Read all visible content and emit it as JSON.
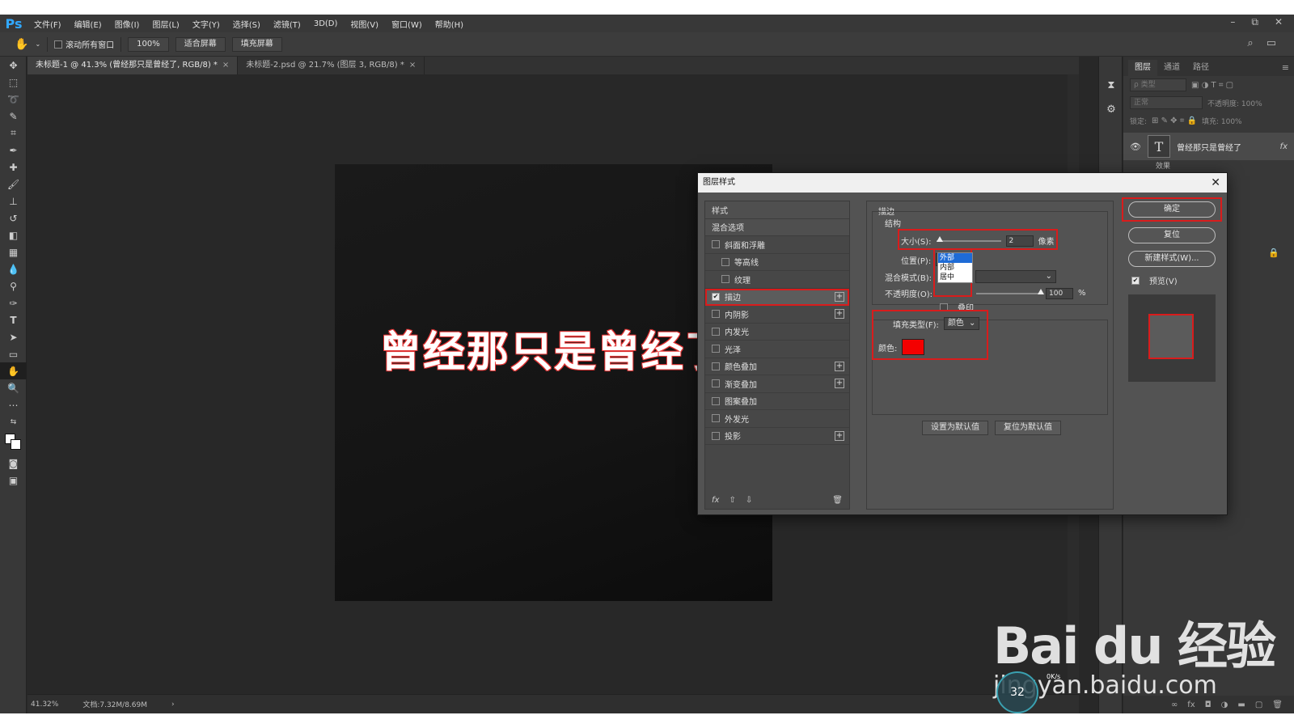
{
  "menubar": {
    "logo": "Ps",
    "items": [
      "文件(F)",
      "编辑(E)",
      "图像(I)",
      "图层(L)",
      "文字(Y)",
      "选择(S)",
      "滤镜(T)",
      "3D(D)",
      "视图(V)",
      "窗口(W)",
      "帮助(H)"
    ],
    "window_controls": [
      "–",
      "⧉",
      "✕"
    ]
  },
  "options": {
    "scroll_all_label": "滚动所有窗口",
    "zoom": "100%",
    "fit_screen": "适合屏幕",
    "fill_screen": "填充屏幕"
  },
  "tabs": [
    {
      "label": "未标题-1 @ 41.3% (曾经那只是曾经了, RGB/8) *",
      "active": true
    },
    {
      "label": "未标题-2.psd @ 21.7% (图层 3, RGB/8) *",
      "active": false
    }
  ],
  "canvas": {
    "text": "曾经那只是曾经了"
  },
  "status": {
    "zoom": "41.32%",
    "doc": "文档:7.32M/8.69M"
  },
  "layers_panel": {
    "tabs": [
      "图层",
      "通道",
      "路径"
    ],
    "filter_placeholder": "ρ 类型",
    "blend_mode": "正常",
    "opacity_label": "不透明度: 100%",
    "lock_label": "锁定:",
    "fill_label": "填充: 100%",
    "layer_name": "曾经那只是曾经了",
    "layer_fx": "fx",
    "effects_label": "效果"
  },
  "dialog": {
    "title": "图层样式",
    "style_list": [
      {
        "label": "样式",
        "type": "header"
      },
      {
        "label": "混合选项",
        "type": "header"
      },
      {
        "label": "斜面和浮雕",
        "checked": false,
        "plus": false
      },
      {
        "label": "等高线",
        "checked": false,
        "sub": true
      },
      {
        "label": "纹理",
        "checked": false,
        "sub": true
      },
      {
        "label": "描边",
        "checked": true,
        "plus": true,
        "selected": true
      },
      {
        "label": "内阴影",
        "checked": false,
        "plus": true
      },
      {
        "label": "内发光",
        "checked": false
      },
      {
        "label": "光泽",
        "checked": false
      },
      {
        "label": "颜色叠加",
        "checked": false,
        "plus": true
      },
      {
        "label": "渐变叠加",
        "checked": false,
        "plus": true
      },
      {
        "label": "图案叠加",
        "checked": false
      },
      {
        "label": "外发光",
        "checked": false
      },
      {
        "label": "投影",
        "checked": false,
        "plus": true
      }
    ],
    "list_footer": {
      "fx": "fx",
      "trash": "🗑"
    },
    "stroke": {
      "section_title": "描边",
      "structure_title": "结构",
      "size_label": "大小(S):",
      "size_value": "2",
      "size_unit": "像素",
      "position_label": "位置(P):",
      "position_value": "外部",
      "position_options": [
        "外部",
        "内部",
        "居中"
      ],
      "blend_label": "混合模式(B):",
      "opacity_label": "不透明度(O):",
      "opacity_value": "100",
      "opacity_unit": "%",
      "overprint_label": "叠印",
      "fill_type_label": "填充类型(F):",
      "fill_type_value": "颜色",
      "color_label": "颜色:",
      "color_hex": "#f40000"
    },
    "make_default": "设置为默认值",
    "reset_default": "复位为默认值",
    "buttons": {
      "ok": "确定",
      "reset": "复位",
      "new_style": "新建样式(W)..."
    },
    "preview_label": "预览(V)"
  },
  "watermark": {
    "logo": "Bai du 经验",
    "url": "jingyan.baidu.com"
  },
  "speed_widget": {
    "value": "32",
    "rate": "0K/s"
  },
  "colors": {
    "accent_red": "#d91c1c",
    "ps_blue": "#31a8ff"
  }
}
